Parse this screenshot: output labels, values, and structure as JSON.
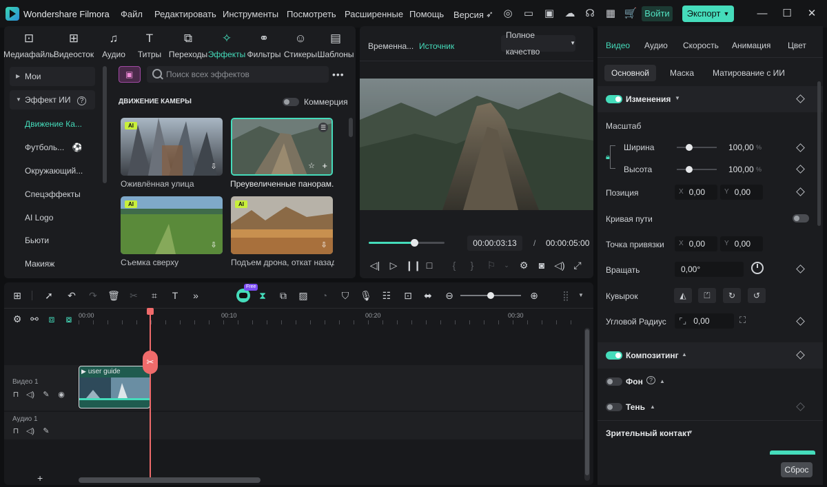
{
  "app": {
    "title": "Wondershare Filmora",
    "menu": [
      "Файл",
      "Редактировать",
      "Инструменты",
      "Посмотреть",
      "Расширенные",
      "Помощь"
    ],
    "version_label": "Версия",
    "login_label": "Войти",
    "export_label": "Экспорт"
  },
  "library": {
    "tabs": [
      {
        "label": "Медиафайлы",
        "icon": "media-icon"
      },
      {
        "label": "Видеосток",
        "icon": "stock-video-icon"
      },
      {
        "label": "Аудио",
        "icon": "music-note-icon"
      },
      {
        "label": "Титры",
        "icon": "text-icon"
      },
      {
        "label": "Переходы",
        "icon": "transition-icon"
      },
      {
        "label": "Эффекты",
        "icon": "sparkle-icon"
      },
      {
        "label": "Фильтры",
        "icon": "filter-icon"
      },
      {
        "label": "Стикеры",
        "icon": "sticker-icon"
      },
      {
        "label": "Шаблоны",
        "icon": "template-icon"
      }
    ],
    "sidebar": [
      {
        "label": "Мои"
      },
      {
        "label": "Эффект ИИ"
      },
      {
        "label": "Движение Ка..."
      },
      {
        "label": "Футболь..."
      },
      {
        "label": "Окружающий..."
      },
      {
        "label": "Спецэффекты"
      },
      {
        "label": "AI Logo"
      },
      {
        "label": "Бьюти"
      },
      {
        "label": "Макияж"
      }
    ],
    "search_placeholder": "Поиск всех эффектов",
    "section_title": "ДВИЖЕНИЕ КАМЕРЫ",
    "commerce_label": "Коммерция",
    "ai_badge": "AI",
    "tiles": [
      {
        "label": "Оживлённая улица"
      },
      {
        "label": "Преувеличенные панорам..."
      },
      {
        "label": "Съемка сверху"
      },
      {
        "label": "Подъем дрона, откат назад"
      }
    ]
  },
  "player": {
    "tab_timeline": "Временна...",
    "tab_source": "Источник",
    "quality": "Полное качество",
    "current_time": "00:00:03:13",
    "separator": "/",
    "total_time": "00:00:05:00",
    "progress": 0.6
  },
  "properties": {
    "top_tabs": [
      "Видео",
      "Аудио",
      "Скорость",
      "Анимация",
      "Цвет"
    ],
    "sub_tabs": [
      "Основной",
      "Маска",
      "Матирование с ИИ"
    ],
    "transform_title": "Изменения",
    "scale_label": "Масштаб",
    "width_label": "Ширина",
    "width_value": "100,00",
    "height_label": "Высота",
    "height_value": "100,00",
    "percent": "%",
    "position_label": "Позиция",
    "pos_x": "0,00",
    "pos_y": "0,00",
    "x_prefix": "X",
    "y_prefix": "Y",
    "path_curve_label": "Кривая пути",
    "anchor_label": "Точка привязки",
    "anchor_x": "0,00",
    "anchor_y": "0,00",
    "rotate_label": "Вращать",
    "rotate_value": "0,00°",
    "flip_label": "Кувырок",
    "corner_label": "Угловой Радиус",
    "corner_value": "0,00",
    "compositing_title": "Композитинг",
    "background_label": "Фон",
    "shadow_label": "Тень",
    "eye_contact_label": "Зрительный контакт",
    "reset_label": "Сброс"
  },
  "timeline": {
    "free_badge": "Free",
    "ruler": [
      "00:00",
      "00:10",
      "00:20",
      "00:30"
    ],
    "video_track": "Видео 1",
    "audio_track": "Аудио 1",
    "clip_name": "user guide",
    "add_track": "+"
  },
  "colors": {
    "accent": "#45dcbb",
    "playhead": "#ef6b6b",
    "background": "#0f1012",
    "panel": "#1b1c1f"
  }
}
